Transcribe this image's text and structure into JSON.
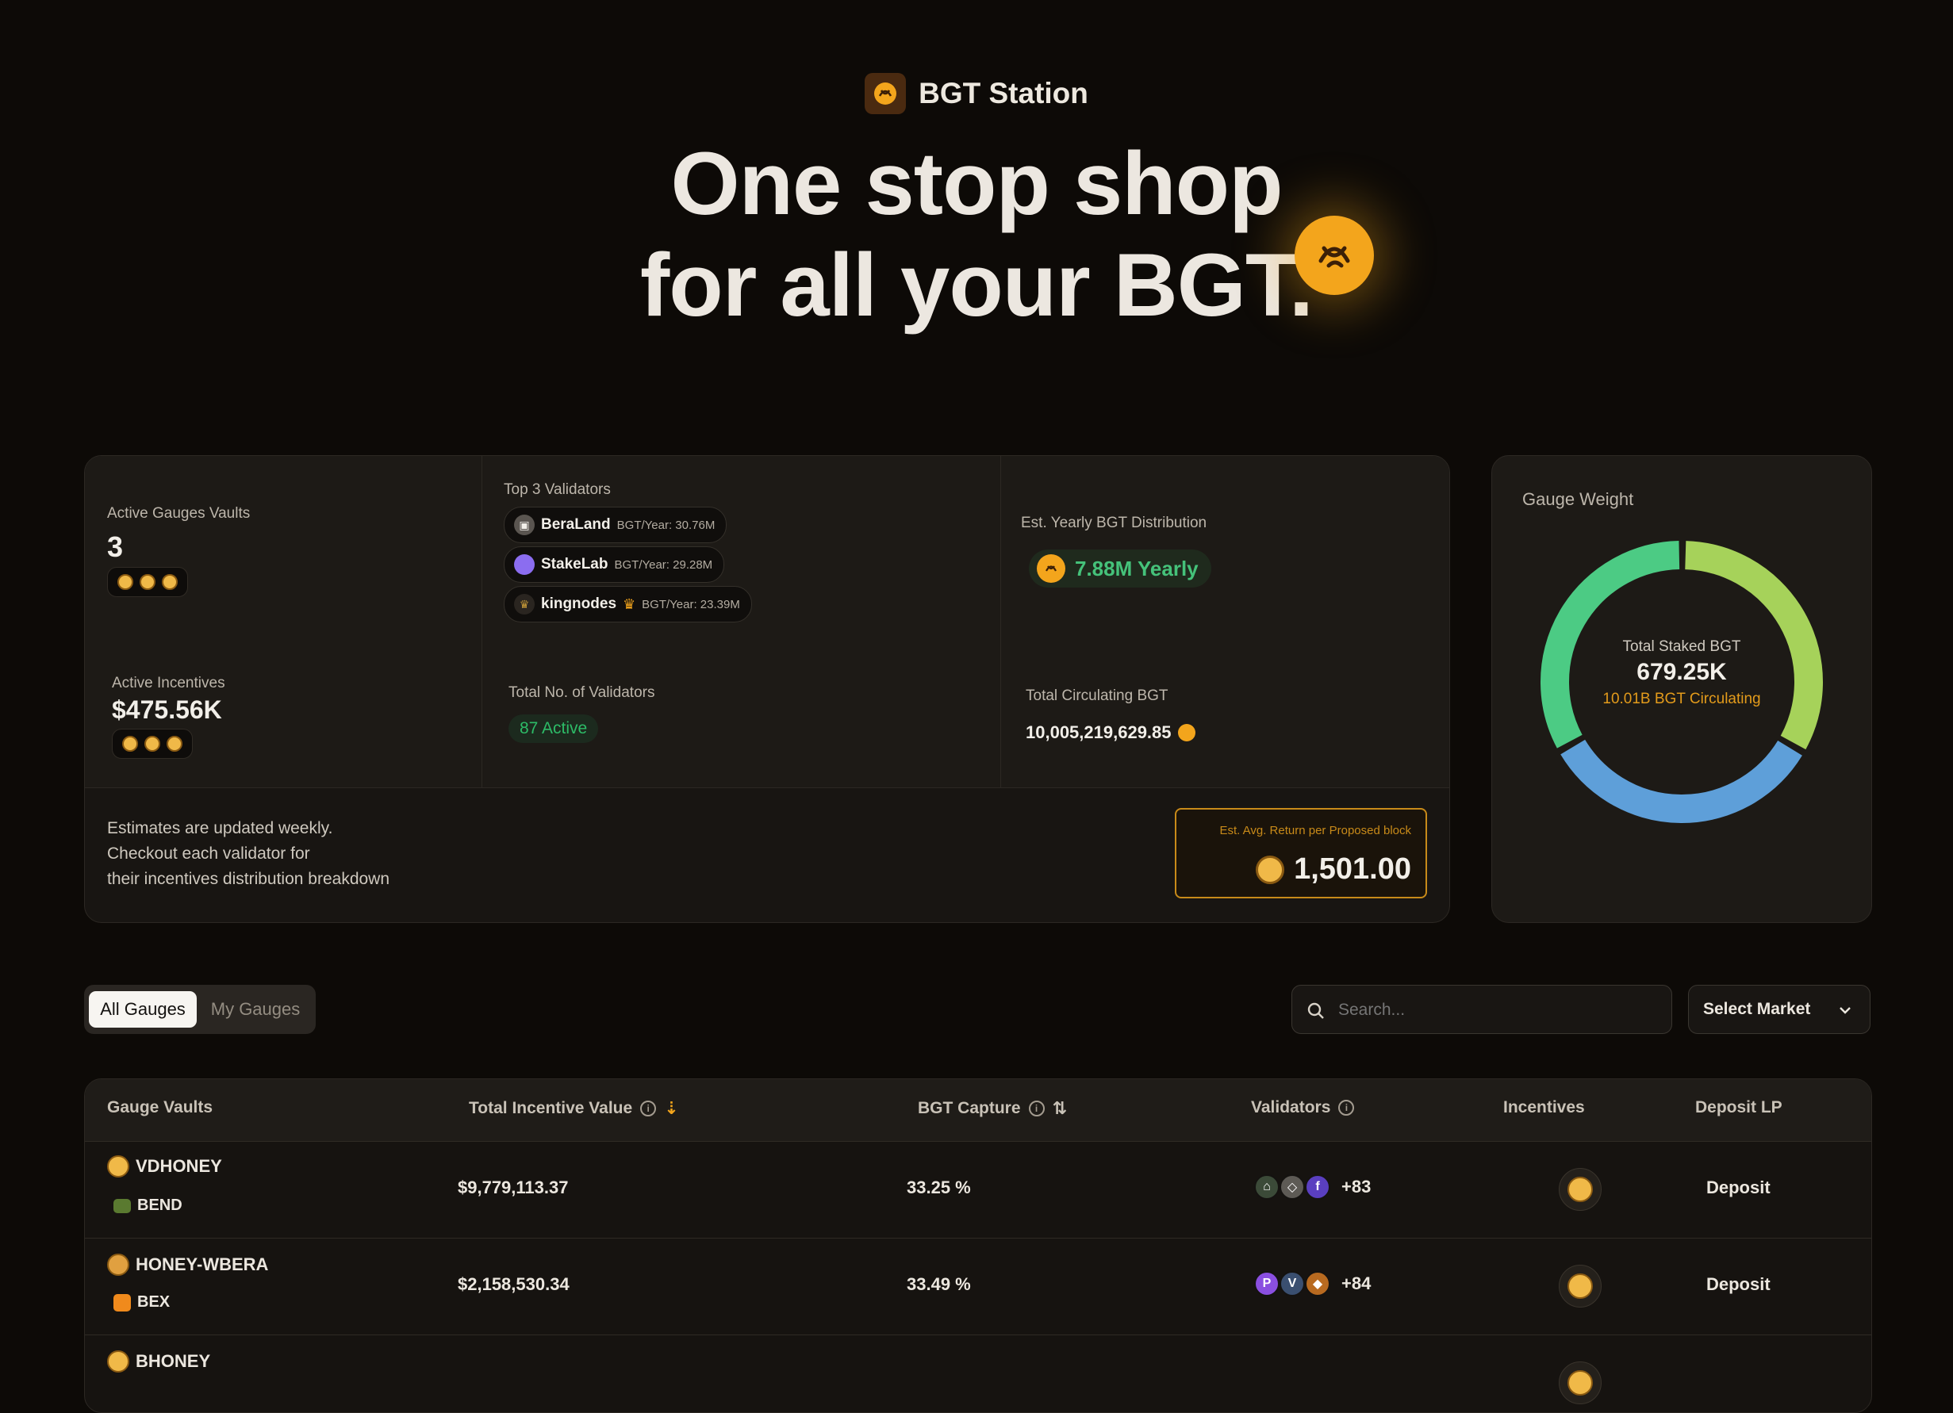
{
  "header": {
    "brand_name": "BGT Station",
    "hero_line1": "One stop shop",
    "hero_line2": "for all your BGT.",
    "brand_icon": "bee-icon"
  },
  "stats": {
    "active_gauges_label": "Active Gauges Vaults",
    "active_gauges_value": "3",
    "top_validators_label": "Top 3 Validators",
    "top_validators": [
      {
        "name": "BeraLand",
        "bgt_year": "BGT/Year: 30.76M",
        "icon": "beraland-icon",
        "color": "#5a5550"
      },
      {
        "name": "StakeLab",
        "bgt_year": "BGT/Year: 29.28M",
        "icon": "stakelab-icon",
        "color": "#8b6df0"
      },
      {
        "name": "kingnodes",
        "bgt_year": "BGT/Year: 23.39M",
        "icon": "kingnodes-icon",
        "color": "#c89a38"
      }
    ],
    "est_yearly_label": "Est. Yearly BGT Distribution",
    "est_yearly_value": "7.88M Yearly",
    "active_incentives_label": "Active Incentives",
    "active_incentives_value": "$475.56K",
    "total_validators_label": "Total No. of Validators",
    "total_validators_value": "87 Active",
    "total_circulating_label": "Total Circulating BGT",
    "total_circulating_value": "10,005,219,629.85",
    "note_line1": "Estimates are updated weekly.",
    "note_line2": "Checkout each validator for",
    "note_line3": "their incentives distribution breakdown",
    "return_label": "Est. Avg. Return per Proposed block",
    "return_value": "1,501.00"
  },
  "gauge_card": {
    "title": "Gauge Weight",
    "center_label": "Total Staked BGT",
    "center_value": "679.25K",
    "center_sub": "10.01B BGT Circulating",
    "segments": [
      {
        "name": "VDHONEY",
        "fraction": 0.3325,
        "color": "#a6d25a"
      },
      {
        "name": "HONEY-WBERA",
        "fraction": 0.3349,
        "color": "#5e9fd9"
      },
      {
        "name": "BHONEY",
        "fraction": 0.3326,
        "color": "#4ccb84"
      }
    ]
  },
  "filters": {
    "tab_all": "All Gauges",
    "tab_my": "My Gauges",
    "search_placeholder": "Search...",
    "market_label": "Select Market"
  },
  "table": {
    "headers": {
      "vaults": "Gauge Vaults",
      "incentive": "Total Incentive Value",
      "capture": "BGT Capture",
      "validators": "Validators",
      "incentives": "Incentives",
      "deposit": "Deposit LP"
    },
    "rows": [
      {
        "vault": "VDHONEY",
        "protocol": "BEND",
        "incentive": "$9,779,113.37",
        "capture": "33.25 %",
        "validators_more": "+83",
        "deposit": "Deposit"
      },
      {
        "vault": "HONEY-WBERA",
        "protocol": "BEX",
        "incentive": "$2,158,530.34",
        "capture": "33.49 %",
        "validators_more": "+84",
        "deposit": "Deposit"
      },
      {
        "vault": "BHONEY",
        "protocol": "",
        "incentive": "",
        "capture": "",
        "validators_more": "",
        "deposit": ""
      }
    ]
  },
  "colors": {
    "accent": "#f3a51c",
    "green": "#45c27a",
    "background": "#0d0a07"
  }
}
